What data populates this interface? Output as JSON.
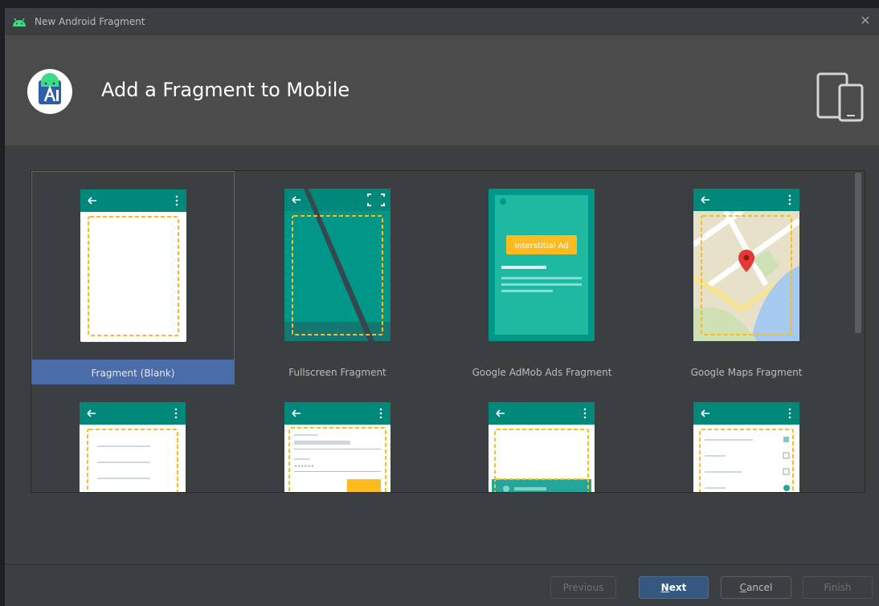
{
  "window": {
    "title": "New Android Fragment",
    "close_glyph": "✕"
  },
  "header": {
    "heading": "Add a Fragment to Mobile",
    "logo_icon": "android-studio-icon",
    "device_icon": "phone-tablet-icon"
  },
  "gallery": {
    "selected_index": 0,
    "templates": [
      {
        "label": "Fragment (Blank)",
        "thumb": "blank"
      },
      {
        "label": "Fullscreen Fragment",
        "thumb": "fullscreen"
      },
      {
        "label": "Google AdMob Ads Fragment",
        "thumb": "admob",
        "ad_label": "Interstitial Ad"
      },
      {
        "label": "Google Maps Fragment",
        "thumb": "maps"
      },
      {
        "label": "",
        "thumb": "list"
      },
      {
        "label": "",
        "thumb": "form"
      },
      {
        "label": "",
        "thumb": "bottom-sheet"
      },
      {
        "label": "",
        "thumb": "settings"
      }
    ]
  },
  "buttons": {
    "previous": "Previous",
    "next_mnemonic": "N",
    "next_rest": "ext",
    "cancel_mnemonic": "C",
    "cancel_rest": "ancel",
    "finish": "Finish"
  },
  "colors": {
    "teal_dark": "#00897b",
    "teal": "#009688",
    "teal_light": "#26a69a",
    "dash": "#fdbb1f",
    "selection": "#4a6ca8",
    "primary_button": "#365880"
  }
}
